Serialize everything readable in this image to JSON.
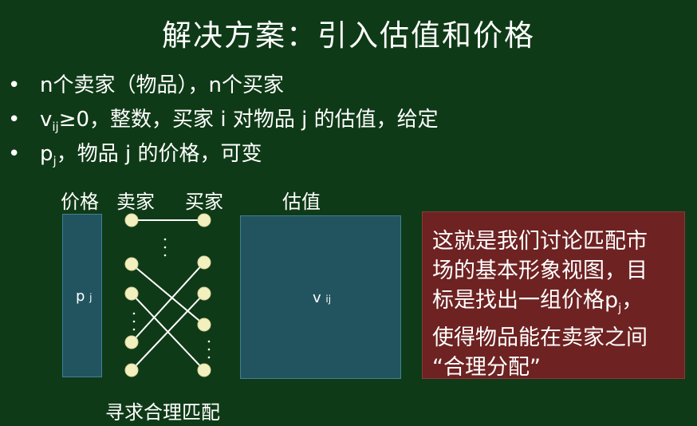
{
  "title": "解决方案：引入估值和价格",
  "bullets": {
    "b1": "n个卖家（物品），n个买家",
    "b2_pre": "v",
    "b2_sub": "ij",
    "b2_post": "≥0，整数，买家 i 对物品 j 的估值，给定",
    "b3_pre": "p",
    "b3_sub": "j",
    "b3_post": "，物品 j 的价格，可变",
    "marker": "•"
  },
  "diagram": {
    "price_label": "价格",
    "seller_label": "卖家",
    "buyer_label": "买家",
    "valuation_label": "估值",
    "price_box_main": "p",
    "price_box_sub": "j",
    "val_box_main": "v",
    "val_box_sub": "ij",
    "caption": "寻求合理匹配",
    "ellipsis": "⋮",
    "colors": {
      "node": "#f3f0c0",
      "edge": "#ffffff",
      "box": "#225460",
      "note_bg": "#6e2222"
    }
  },
  "note": {
    "line1": "这就是我们讨论匹配市",
    "line2": "场的基本形象视图，目",
    "line3_pre": "标是找出一组价格p",
    "line3_sub": "j",
    "line3_post": "，",
    "line4": "使得物品能在卖家之间",
    "line5": "“合理分配”"
  }
}
